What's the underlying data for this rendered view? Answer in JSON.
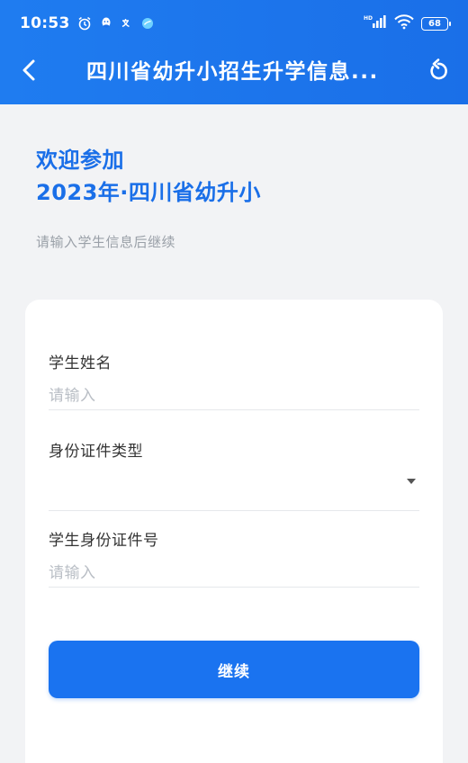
{
  "status_bar": {
    "time": "10:53",
    "left_icons": [
      "alarm-icon",
      "qq-icon",
      "translate-icon",
      "app-icon"
    ],
    "network": "HD",
    "battery": "68"
  },
  "nav": {
    "title": "四川省幼升小招生升学信息...",
    "back_icon": "chevron-left-icon",
    "refresh_icon": "refresh-icon"
  },
  "intro": {
    "welcome_line1": "欢迎参加",
    "welcome_line2": "2023年·四川省幼升小",
    "hint": "请输入学生信息后继续"
  },
  "form": {
    "student_name": {
      "label": "学生姓名",
      "placeholder": "请输入",
      "value": ""
    },
    "id_type": {
      "label": "身份证件类型",
      "selected": ""
    },
    "id_number": {
      "label": "学生身份证件号",
      "placeholder": "请输入",
      "value": ""
    },
    "continue_label": "继续"
  },
  "colors": {
    "header": "#1a6fe8",
    "accent": "#1a73f0",
    "page_bg": "#f2f3f5",
    "hint_text": "#9aa0a8"
  }
}
